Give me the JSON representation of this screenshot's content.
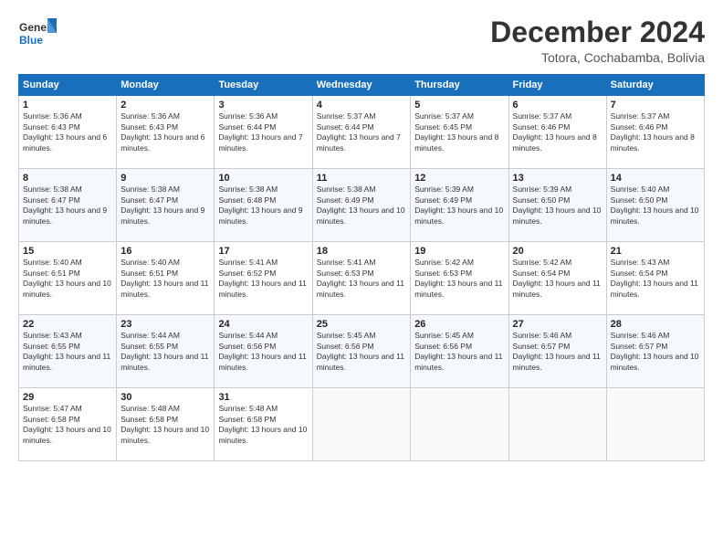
{
  "logo": {
    "line1": "General",
    "line2": "Blue"
  },
  "title": "December 2024",
  "subtitle": "Totora, Cochabamba, Bolivia",
  "days_of_week": [
    "Sunday",
    "Monday",
    "Tuesday",
    "Wednesday",
    "Thursday",
    "Friday",
    "Saturday"
  ],
  "weeks": [
    [
      {
        "day": "1",
        "info": "Sunrise: 5:36 AM\nSunset: 6:43 PM\nDaylight: 13 hours and 6 minutes."
      },
      {
        "day": "2",
        "info": "Sunrise: 5:36 AM\nSunset: 6:43 PM\nDaylight: 13 hours and 6 minutes."
      },
      {
        "day": "3",
        "info": "Sunrise: 5:36 AM\nSunset: 6:44 PM\nDaylight: 13 hours and 7 minutes."
      },
      {
        "day": "4",
        "info": "Sunrise: 5:37 AM\nSunset: 6:44 PM\nDaylight: 13 hours and 7 minutes."
      },
      {
        "day": "5",
        "info": "Sunrise: 5:37 AM\nSunset: 6:45 PM\nDaylight: 13 hours and 8 minutes."
      },
      {
        "day": "6",
        "info": "Sunrise: 5:37 AM\nSunset: 6:46 PM\nDaylight: 13 hours and 8 minutes."
      },
      {
        "day": "7",
        "info": "Sunrise: 5:37 AM\nSunset: 6:46 PM\nDaylight: 13 hours and 8 minutes."
      }
    ],
    [
      {
        "day": "8",
        "info": "Sunrise: 5:38 AM\nSunset: 6:47 PM\nDaylight: 13 hours and 9 minutes."
      },
      {
        "day": "9",
        "info": "Sunrise: 5:38 AM\nSunset: 6:47 PM\nDaylight: 13 hours and 9 minutes."
      },
      {
        "day": "10",
        "info": "Sunrise: 5:38 AM\nSunset: 6:48 PM\nDaylight: 13 hours and 9 minutes."
      },
      {
        "day": "11",
        "info": "Sunrise: 5:38 AM\nSunset: 6:49 PM\nDaylight: 13 hours and 10 minutes."
      },
      {
        "day": "12",
        "info": "Sunrise: 5:39 AM\nSunset: 6:49 PM\nDaylight: 13 hours and 10 minutes."
      },
      {
        "day": "13",
        "info": "Sunrise: 5:39 AM\nSunset: 6:50 PM\nDaylight: 13 hours and 10 minutes."
      },
      {
        "day": "14",
        "info": "Sunrise: 5:40 AM\nSunset: 6:50 PM\nDaylight: 13 hours and 10 minutes."
      }
    ],
    [
      {
        "day": "15",
        "info": "Sunrise: 5:40 AM\nSunset: 6:51 PM\nDaylight: 13 hours and 10 minutes."
      },
      {
        "day": "16",
        "info": "Sunrise: 5:40 AM\nSunset: 6:51 PM\nDaylight: 13 hours and 11 minutes."
      },
      {
        "day": "17",
        "info": "Sunrise: 5:41 AM\nSunset: 6:52 PM\nDaylight: 13 hours and 11 minutes."
      },
      {
        "day": "18",
        "info": "Sunrise: 5:41 AM\nSunset: 6:53 PM\nDaylight: 13 hours and 11 minutes."
      },
      {
        "day": "19",
        "info": "Sunrise: 5:42 AM\nSunset: 6:53 PM\nDaylight: 13 hours and 11 minutes."
      },
      {
        "day": "20",
        "info": "Sunrise: 5:42 AM\nSunset: 6:54 PM\nDaylight: 13 hours and 11 minutes."
      },
      {
        "day": "21",
        "info": "Sunrise: 5:43 AM\nSunset: 6:54 PM\nDaylight: 13 hours and 11 minutes."
      }
    ],
    [
      {
        "day": "22",
        "info": "Sunrise: 5:43 AM\nSunset: 6:55 PM\nDaylight: 13 hours and 11 minutes."
      },
      {
        "day": "23",
        "info": "Sunrise: 5:44 AM\nSunset: 6:55 PM\nDaylight: 13 hours and 11 minutes."
      },
      {
        "day": "24",
        "info": "Sunrise: 5:44 AM\nSunset: 6:56 PM\nDaylight: 13 hours and 11 minutes."
      },
      {
        "day": "25",
        "info": "Sunrise: 5:45 AM\nSunset: 6:56 PM\nDaylight: 13 hours and 11 minutes."
      },
      {
        "day": "26",
        "info": "Sunrise: 5:45 AM\nSunset: 6:56 PM\nDaylight: 13 hours and 11 minutes."
      },
      {
        "day": "27",
        "info": "Sunrise: 5:46 AM\nSunset: 6:57 PM\nDaylight: 13 hours and 11 minutes."
      },
      {
        "day": "28",
        "info": "Sunrise: 5:46 AM\nSunset: 6:57 PM\nDaylight: 13 hours and 10 minutes."
      }
    ],
    [
      {
        "day": "29",
        "info": "Sunrise: 5:47 AM\nSunset: 6:58 PM\nDaylight: 13 hours and 10 minutes."
      },
      {
        "day": "30",
        "info": "Sunrise: 5:48 AM\nSunset: 6:58 PM\nDaylight: 13 hours and 10 minutes."
      },
      {
        "day": "31",
        "info": "Sunrise: 5:48 AM\nSunset: 6:58 PM\nDaylight: 13 hours and 10 minutes."
      },
      {
        "day": "",
        "info": ""
      },
      {
        "day": "",
        "info": ""
      },
      {
        "day": "",
        "info": ""
      },
      {
        "day": "",
        "info": ""
      }
    ]
  ]
}
